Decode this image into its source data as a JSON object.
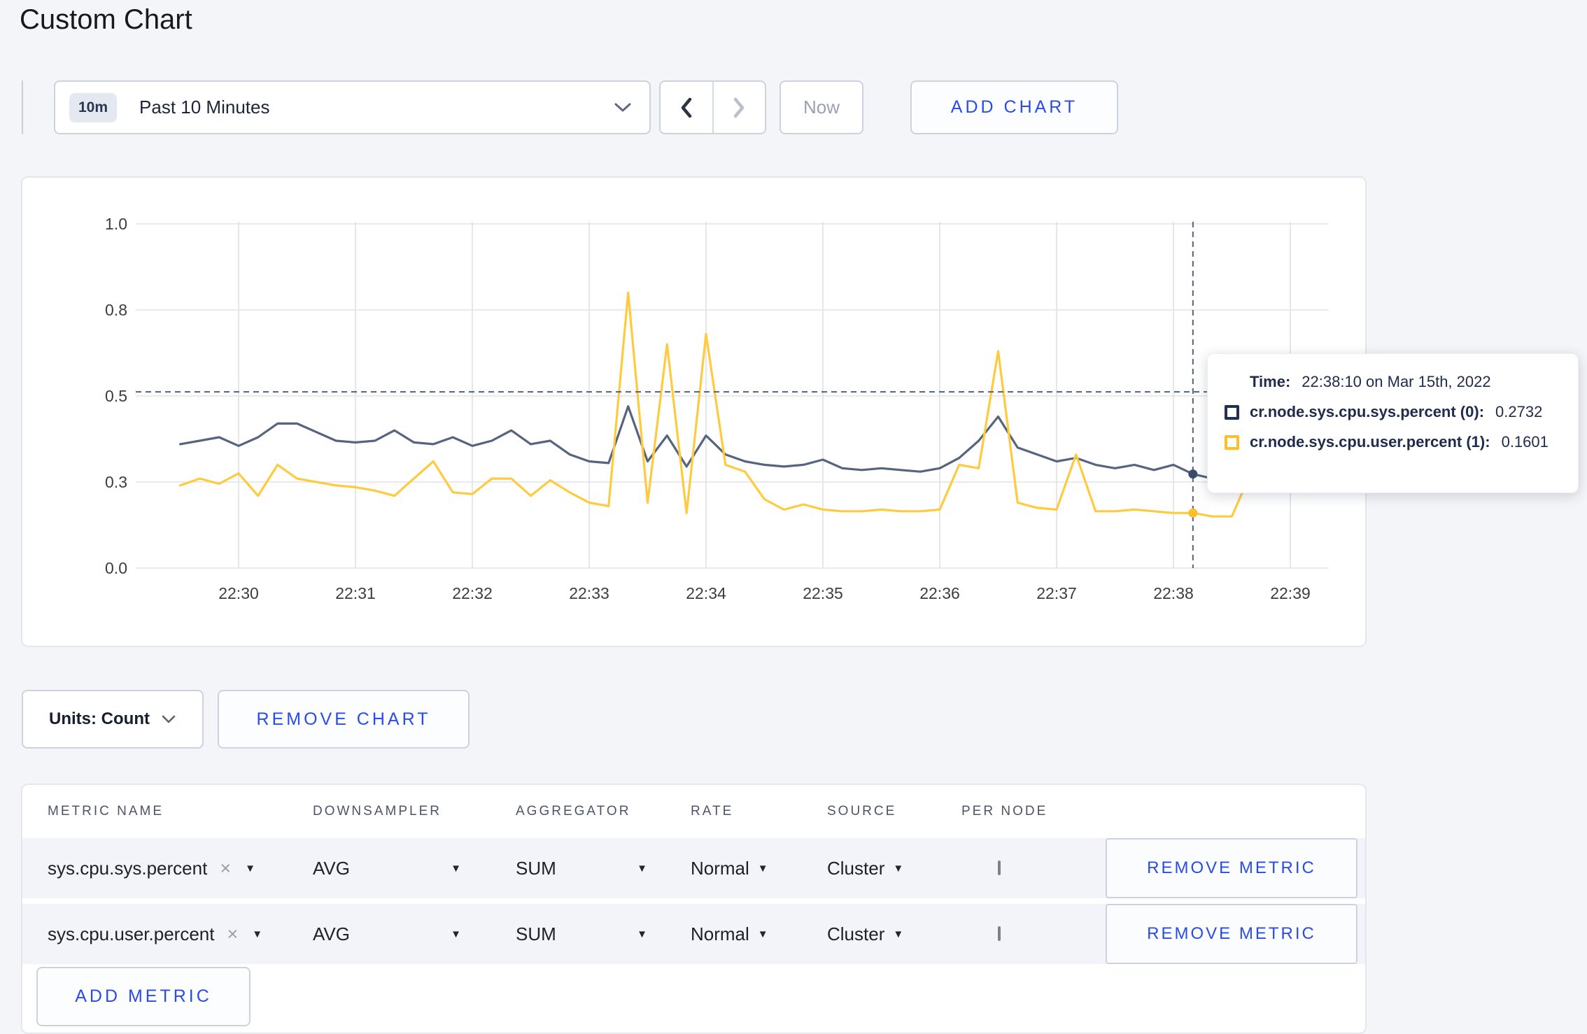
{
  "page": {
    "title": "Custom Chart",
    "background": "#f4f5f9",
    "accent_blue": "#2a4be8"
  },
  "toolbar": {
    "time_window": {
      "badge": "10m",
      "label": "Past 10 Minutes"
    },
    "now_label": "Now",
    "add_chart_label": "ADD CHART"
  },
  "chart_data": {
    "type": "line",
    "title": "",
    "xlabel": "",
    "ylabel": "",
    "ylim": [
      0,
      1
    ],
    "grid": true,
    "legend_position": "tooltip",
    "x_ticks": [
      "22:30",
      "22:31",
      "22:32",
      "22:33",
      "22:34",
      "22:35",
      "22:36",
      "22:37",
      "22:38",
      "22:39"
    ],
    "y_ticks": [
      {
        "value": 0.0,
        "label": "0.0"
      },
      {
        "value": 0.25,
        "label": "0.3"
      },
      {
        "value": 0.5,
        "label": "0.5"
      },
      {
        "value": 0.75,
        "label": "0.8"
      },
      {
        "value": 1.0,
        "label": "1.0"
      }
    ],
    "x_start": "22:29:30",
    "x_interval_seconds": 10,
    "series": [
      {
        "name": "cr.node.sys.cpu.sys.percent",
        "node": "0",
        "color": "#55647f",
        "values": [
          0.36,
          0.37,
          0.38,
          0.355,
          0.38,
          0.42,
          0.42,
          0.395,
          0.37,
          0.365,
          0.37,
          0.4,
          0.365,
          0.36,
          0.38,
          0.355,
          0.37,
          0.4,
          0.36,
          0.37,
          0.33,
          0.31,
          0.305,
          0.47,
          0.31,
          0.385,
          0.295,
          0.385,
          0.33,
          0.31,
          0.3,
          0.295,
          0.3,
          0.315,
          0.29,
          0.285,
          0.29,
          0.285,
          0.28,
          0.29,
          0.32,
          0.37,
          0.44,
          0.35,
          0.33,
          0.31,
          0.32,
          0.3,
          0.29,
          0.3,
          0.285,
          0.3,
          0.2732,
          0.26,
          0.28,
          0.31,
          0.33,
          0.3,
          0.295,
          0.31
        ]
      },
      {
        "name": "cr.node.sys.cpu.user.percent",
        "node": "1",
        "color": "#fecb3f",
        "values": [
          0.24,
          0.26,
          0.245,
          0.275,
          0.21,
          0.3,
          0.26,
          0.25,
          0.24,
          0.235,
          0.225,
          0.21,
          0.26,
          0.31,
          0.22,
          0.215,
          0.26,
          0.26,
          0.21,
          0.255,
          0.22,
          0.19,
          0.18,
          0.8,
          0.19,
          0.65,
          0.16,
          0.68,
          0.3,
          0.28,
          0.2,
          0.17,
          0.185,
          0.17,
          0.165,
          0.165,
          0.17,
          0.165,
          0.165,
          0.17,
          0.3,
          0.29,
          0.63,
          0.19,
          0.175,
          0.17,
          0.33,
          0.165,
          0.165,
          0.17,
          0.165,
          0.16,
          0.1601,
          0.15,
          0.15,
          0.28,
          0.3,
          0.27,
          0.22,
          0.27
        ]
      }
    ],
    "crosshair": {
      "time": "22:38:10",
      "t_seconds_from_22_30": 490,
      "hline_value": 0.512,
      "values": [
        0.2732,
        0.1601
      ]
    }
  },
  "tooltip": {
    "time_label": "Time:",
    "time_value": "22:38:10 on Mar 15th, 2022",
    "series": [
      {
        "swatch_color": "#202f52",
        "label": "cr.node.sys.cpu.sys.percent (0):",
        "value": "0.2732"
      },
      {
        "swatch_color": "#fdbe2a",
        "label": "cr.node.sys.cpu.user.percent (1):",
        "value": "0.1601"
      }
    ]
  },
  "chart_footer": {
    "units_label": "Units: Count",
    "remove_chart_label": "REMOVE CHART"
  },
  "metrics_table": {
    "columns": [
      "METRIC NAME",
      "DOWNSAMPLER",
      "AGGREGATOR",
      "RATE",
      "SOURCE",
      "PER NODE"
    ],
    "icons": {
      "caret": "▼",
      "clear": "×"
    },
    "rows": [
      {
        "metric": "sys.cpu.sys.percent",
        "downsampler": "AVG",
        "aggregator": "SUM",
        "rate": "Normal",
        "source": "Cluster",
        "per_node_checked": false,
        "action": "REMOVE METRIC"
      },
      {
        "metric": "sys.cpu.user.percent",
        "downsampler": "AVG",
        "aggregator": "SUM",
        "rate": "Normal",
        "source": "Cluster",
        "per_node_checked": false,
        "action": "REMOVE METRIC"
      }
    ],
    "add_metric_label": "ADD METRIC"
  }
}
